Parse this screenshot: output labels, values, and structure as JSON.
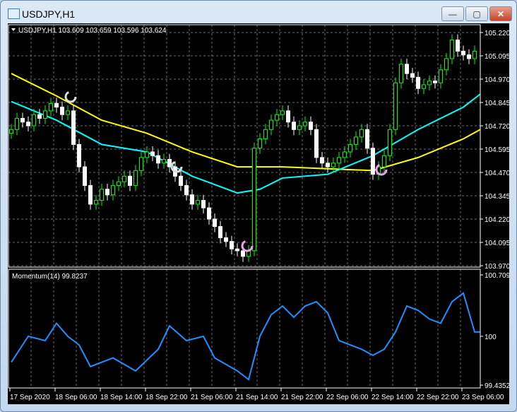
{
  "window": {
    "title": "USDJPY,H1",
    "minimize": "—",
    "maximize": "▢",
    "close": "✕"
  },
  "header": {
    "symbol_info": "USDJPY,H1  103.609 103.659 103.596 103.624"
  },
  "indicator": {
    "label": "Momentum(14) 99.8237"
  },
  "colors": {
    "bull": "#00ff00",
    "bear": "#ffffff",
    "ma_slow": "#ffff00",
    "ma_fast": "#00ffff",
    "momentum": "#1e90ff",
    "grid": "#6c6c6c"
  },
  "price_axis": [
    "105.220",
    "105.095",
    "104.970",
    "104.845",
    "104.720",
    "104.595",
    "104.470",
    "104.345",
    "104.220",
    "104.095",
    "103.970"
  ],
  "momentum_axis": [
    "100.7096",
    "100",
    "99.4352"
  ],
  "time_axis": [
    "17 Sep 2020",
    "18 Sep 06:00",
    "18 Sep 14:00",
    "18 Sep 22:00",
    "21 Sep 06:00",
    "21 Sep 14:00",
    "21 Sep 22:00",
    "22 Sep 06:00",
    "22 Sep 14:00",
    "22 Sep 22:00",
    "23 Sep 06:00"
  ],
  "chart_data": {
    "type": "candlestick",
    "price_range": [
      103.97,
      105.22
    ],
    "momentum_range": [
      99.4352,
      100.7096
    ],
    "closes": [
      104.7,
      104.76,
      104.74,
      104.72,
      104.78,
      104.76,
      104.8,
      104.84,
      104.82,
      104.78,
      104.8,
      104.62,
      104.5,
      104.4,
      104.3,
      104.32,
      104.38,
      104.35,
      104.4,
      104.42,
      104.45,
      104.4,
      104.48,
      104.55,
      104.58,
      104.56,
      104.52,
      104.54,
      104.5,
      104.45,
      104.4,
      104.35,
      104.3,
      104.32,
      104.28,
      104.22,
      104.18,
      104.12,
      104.1,
      104.06,
      104.05,
      104.02,
      104.05,
      104.6,
      104.65,
      104.7,
      104.75,
      104.78,
      104.8,
      104.74,
      104.7,
      104.72,
      104.74,
      104.7,
      104.55,
      104.52,
      104.5,
      104.52,
      104.55,
      104.58,
      104.62,
      104.66,
      104.7,
      104.6,
      104.46,
      104.5,
      104.56,
      104.7,
      104.95,
      105.05,
      105.0,
      104.98,
      104.92,
      104.94,
      104.96,
      104.95,
      105.02,
      105.08,
      105.18,
      105.12,
      105.1,
      105.08,
      105.12
    ],
    "ma_slow": {
      "bars": [
        0,
        8,
        16,
        24,
        32,
        40,
        48,
        56,
        64,
        72,
        80,
        83
      ],
      "values": [
        105.0,
        104.88,
        104.75,
        104.68,
        104.58,
        104.5,
        104.5,
        104.49,
        104.48,
        104.55,
        104.65,
        104.7
      ]
    },
    "ma_fast": {
      "bars": [
        0,
        8,
        16,
        24,
        32,
        40,
        44,
        48,
        56,
        64,
        72,
        80,
        83
      ],
      "values": [
        104.85,
        104.75,
        104.62,
        104.58,
        104.45,
        104.36,
        104.38,
        104.44,
        104.46,
        104.56,
        104.7,
        104.82,
        104.89
      ]
    },
    "momentum": {
      "bars": [
        0,
        3,
        6,
        8,
        10,
        12,
        14,
        18,
        22,
        26,
        28,
        31,
        34,
        36,
        40,
        42,
        44,
        46,
        48,
        50,
        52,
        54,
        56,
        58,
        62,
        64,
        66,
        68,
        70,
        72,
        74,
        76,
        78,
        80,
        82,
        83
      ],
      "values": [
        99.7,
        100,
        99.95,
        100.15,
        100.0,
        99.9,
        99.65,
        99.75,
        99.6,
        99.85,
        100.12,
        99.95,
        100.0,
        99.75,
        99.6,
        99.5,
        100.0,
        100.25,
        100.35,
        100.22,
        100.35,
        100.4,
        100.27,
        99.95,
        99.85,
        99.78,
        99.85,
        100.05,
        100.35,
        100.3,
        100.2,
        100.15,
        100.4,
        100.5,
        100.05,
        100.05
      ]
    }
  }
}
